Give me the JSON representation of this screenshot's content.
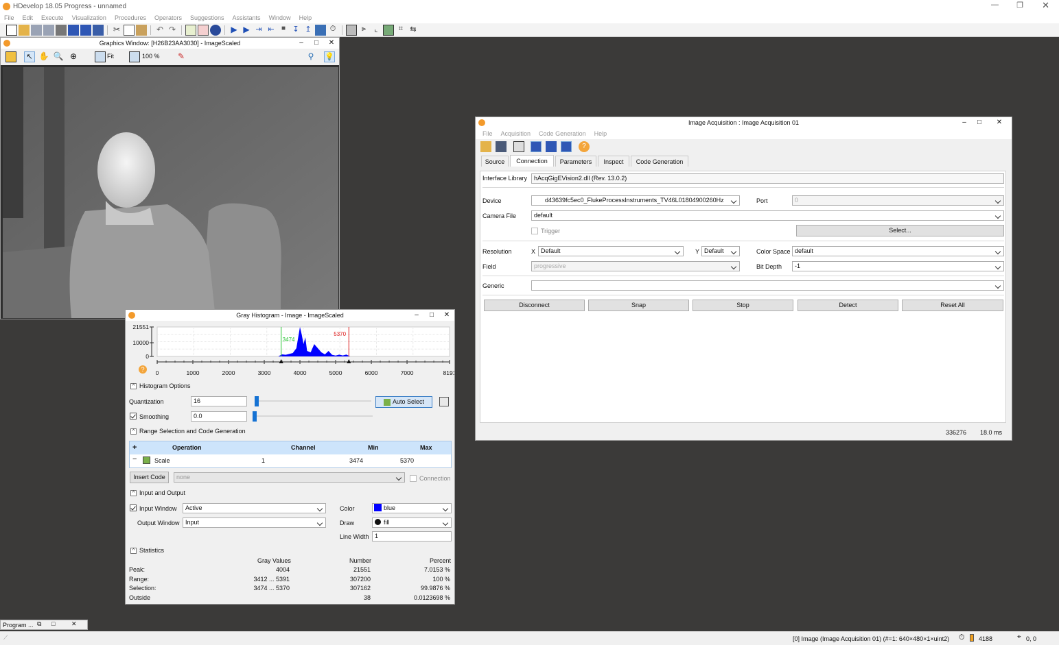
{
  "app": {
    "title": "HDevelop 18.05 Progress - unnamed"
  },
  "menu": [
    "File",
    "Edit",
    "Execute",
    "Visualization",
    "Procedures",
    "Operators",
    "Suggestions",
    "Assistants",
    "Window",
    "Help"
  ],
  "graphics": {
    "title": "Graphics Window: [H26B23AA3030] - ImageScaled",
    "fit_label": "Fit",
    "zoom_label": "100 %"
  },
  "histogram": {
    "title": "Gray Histogram - Image - ImageScaled",
    "y_ticks": [
      "21551",
      "10000",
      "0"
    ],
    "x_ticks": [
      "0",
      "1000",
      "2000",
      "3000",
      "4000",
      "5000",
      "6000",
      "7000",
      "8191"
    ],
    "min_marker": "3474",
    "max_marker": "5370",
    "options_header": "Histogram Options",
    "quantization_label": "Quantization",
    "quantization_value": "16",
    "auto_select_label": "Auto Select",
    "smoothing_label": "Smoothing",
    "smoothing_value": "0.0",
    "range_header": "Range Selection and Code Generation",
    "table_headers": [
      "Operation",
      "Channel",
      "Min",
      "Max"
    ],
    "table_row": {
      "operation": "Scale",
      "channel": "1",
      "min": "3474",
      "max": "5370"
    },
    "insert_code_label": "Insert Code",
    "insert_code_combo": "none",
    "connection_label": "Connection",
    "io_header": "Input and Output",
    "input_window_label": "Input Window",
    "input_window_value": "Active",
    "output_window_label": "Output Window",
    "output_window_value": "Input",
    "color_label": "Color",
    "color_value": "blue",
    "draw_label": "Draw",
    "draw_value": "fill",
    "line_width_label": "Line Width",
    "line_width_value": "1",
    "stats_header": "Statistics",
    "stats_cols": [
      "Gray Values",
      "Number",
      "Percent"
    ],
    "stats_rows": [
      {
        "label": "Peak:",
        "gray": "4004",
        "number": "21551",
        "percent": "7.0153 %"
      },
      {
        "label": "Range:",
        "gray": "3412 ... 5391",
        "number": "307200",
        "percent": "100 %"
      },
      {
        "label": "Selection:",
        "gray": "3474 ... 5370",
        "number": "307162",
        "percent": "99.9876 %"
      },
      {
        "label": "Outside",
        "gray": "",
        "number": "38",
        "percent": "0.0123698 %"
      }
    ],
    "chart_data": {
      "type": "area",
      "x": [
        3400,
        3500,
        3600,
        3700,
        3800,
        3900,
        4000,
        4050,
        4100,
        4150,
        4200,
        4300,
        4400,
        4500,
        4600,
        4700,
        4800,
        4900,
        5000,
        5100,
        5200,
        5300,
        5400
      ],
      "values": [
        200,
        1500,
        1200,
        1800,
        2500,
        6000,
        21551,
        16000,
        9000,
        14000,
        4000,
        3000,
        9000,
        6000,
        3000,
        1500,
        4000,
        1200,
        600,
        1300,
        700,
        1400,
        100
      ],
      "xlim": [
        0,
        8191
      ],
      "ylim": [
        0,
        21551
      ],
      "color": "#0000ff"
    }
  },
  "acquisition": {
    "title": "Image Acquisition : Image Acquisition 01",
    "menu": [
      "File",
      "Acquisition",
      "Code Generation",
      "Help"
    ],
    "tabs": [
      "Source",
      "Connection",
      "Parameters",
      "Inspect",
      "Code Generation"
    ],
    "interface_library_label": "Interface Library",
    "interface_library_value": "hAcqGigEVision2.dll (Rev. 13.0.2)",
    "device_label": "Device",
    "device_value": "d43639fc5ec0_FlukeProcessInstruments_TV46L01804900260Hz",
    "port_label": "Port",
    "port_value": "0",
    "camera_file_label": "Camera File",
    "camera_file_value": "default",
    "trigger_label": "Trigger",
    "select_label": "Select...",
    "resolution_label": "Resolution",
    "x_label": "X",
    "x_value": "Default",
    "y_label": "Y",
    "y_value": "Default",
    "color_space_label": "Color Space",
    "color_space_value": "default",
    "field_label": "Field",
    "field_value": "progressive",
    "bit_depth_label": "Bit Depth",
    "bit_depth_value": "-1",
    "generic_label": "Generic",
    "buttons": [
      "Disconnect",
      "Snap",
      "Stop",
      "Detect",
      "Reset All"
    ],
    "status_count": "336276",
    "status_time": "18.0 ms"
  },
  "program_tab": "Program ...",
  "statusbar": {
    "image_info": "[0] Image (Image Acquisition 01) (#=1: 640×480×1×uint2)",
    "value": "4188",
    "coords": "0, 0"
  }
}
